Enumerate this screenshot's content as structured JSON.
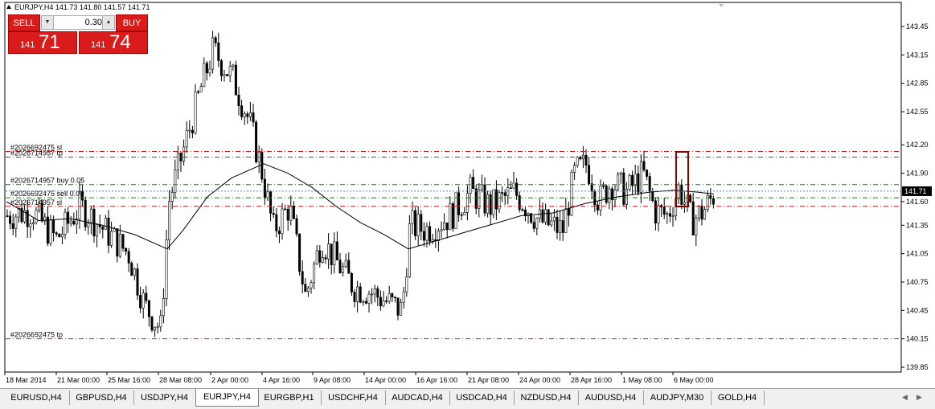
{
  "chart": {
    "title": "EURJPY,H4  141.73 141.80 141.57 141.71",
    "bid_label": "141.71"
  },
  "trade_panel": {
    "sell_label": "SELL",
    "buy_label": "BUY",
    "lot_value": "0.30",
    "sell_price_small": "141",
    "sell_price_big": "71",
    "buy_price_small": "141",
    "buy_price_big": "74"
  },
  "colors": {
    "candle": "#000000",
    "order_sl_tp": "#cc1a1a",
    "order_open": "#1a7a1a",
    "highlight_box": "#8b0000",
    "bid_line": "#4a8aa8",
    "ma_line": "#000000"
  },
  "icons": {
    "left_arrow": "triangle-left-icon",
    "right_arrow": "triangle-right-icon"
  },
  "chart_data": {
    "type": "candlestick",
    "symbol": "EURJPY",
    "timeframe": "H4",
    "ohlc": {
      "open": 141.73,
      "high": 141.8,
      "low": 141.57,
      "close": 141.71
    },
    "ylim": [
      139.85,
      143.55
    ],
    "y_ticks": [
      "143.45",
      "143.15",
      "142.85",
      "142.55",
      "142.20",
      "141.90",
      "141.60",
      "141.35",
      "141.05",
      "140.75",
      "140.45",
      "140.15",
      "139.85"
    ],
    "x_ticks": [
      "18 Mar 2014",
      "21 Mar 00:00",
      "25 Mar 16:00",
      "28 Mar 08:00",
      "2 Apr 00:00",
      "4 Apr 16:00",
      "9 Apr 08:00",
      "14 Apr 00:00",
      "16 Apr 16:00",
      "21 Apr 08:00",
      "24 Apr 00:00",
      "28 Apr 16:00",
      "1 May 08:00",
      "6 May 00:00"
    ],
    "order_lines": [
      {
        "label": "#2026692475 sl",
        "price": 142.13,
        "kind": "sl"
      },
      {
        "label": "#2026714957 tp",
        "price": 142.07,
        "kind": "sl"
      },
      {
        "label": "#2026714957 buy 0.05",
        "price": 141.78,
        "kind": "open"
      },
      {
        "label": "#2026692475 sell 0.06",
        "price": 141.64,
        "kind": "open"
      },
      {
        "label": "#2026714957 sl",
        "price": 141.55,
        "kind": "sl"
      },
      {
        "label": "#2026692475 tp",
        "price": 140.15,
        "kind": "sl"
      }
    ],
    "ma_points": [
      [
        0,
        141.6
      ],
      [
        40,
        141.4
      ],
      [
        80,
        141.42
      ],
      [
        120,
        141.35
      ],
      [
        160,
        141.25
      ],
      [
        200,
        141.1
      ],
      [
        220,
        141.3
      ],
      [
        250,
        141.65
      ],
      [
        280,
        141.85
      ],
      [
        320,
        142.0
      ],
      [
        350,
        141.9
      ],
      [
        380,
        141.75
      ],
      [
        410,
        141.55
      ],
      [
        440,
        141.38
      ],
      [
        470,
        141.25
      ],
      [
        500,
        141.1
      ],
      [
        520,
        141.15
      ],
      [
        560,
        141.25
      ],
      [
        600,
        141.35
      ],
      [
        640,
        141.45
      ],
      [
        680,
        141.48
      ],
      [
        720,
        141.58
      ],
      [
        760,
        141.65
      ],
      [
        800,
        141.7
      ],
      [
        830,
        141.72
      ],
      [
        860,
        141.7
      ],
      [
        880,
        141.68
      ]
    ]
  },
  "tabs": [
    "EURUSD,H4",
    "GBPUSD,H4",
    "USDJPY,H4",
    "EURJPY,H4",
    "EURGBP,H1",
    "USDCHF,H4",
    "AUDCAD,H4",
    "USDCAD,H4",
    "NZDUSD,H4",
    "AUDUSD,H4",
    "AUDJPY,M30",
    "GOLD,H4"
  ],
  "active_tab": "EURJPY,H4"
}
